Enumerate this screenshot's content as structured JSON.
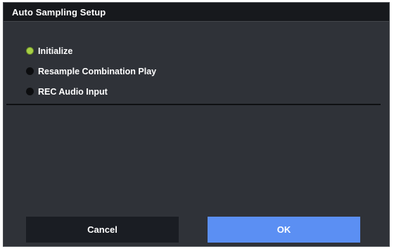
{
  "dialog": {
    "title": "Auto Sampling Setup",
    "options": [
      {
        "label": "Initialize",
        "selected": true
      },
      {
        "label": "Resample Combination Play",
        "selected": false
      },
      {
        "label": "REC Audio Input",
        "selected": false
      }
    ],
    "buttons": {
      "cancel_label": "Cancel",
      "ok_label": "OK"
    }
  },
  "colors": {
    "dialog_bg": "#2f3238",
    "titlebar_bg": "#17191d",
    "radio_selected": "#a6cf45",
    "ok_button": "#5b8ff3",
    "cancel_button": "#1a1d23"
  }
}
